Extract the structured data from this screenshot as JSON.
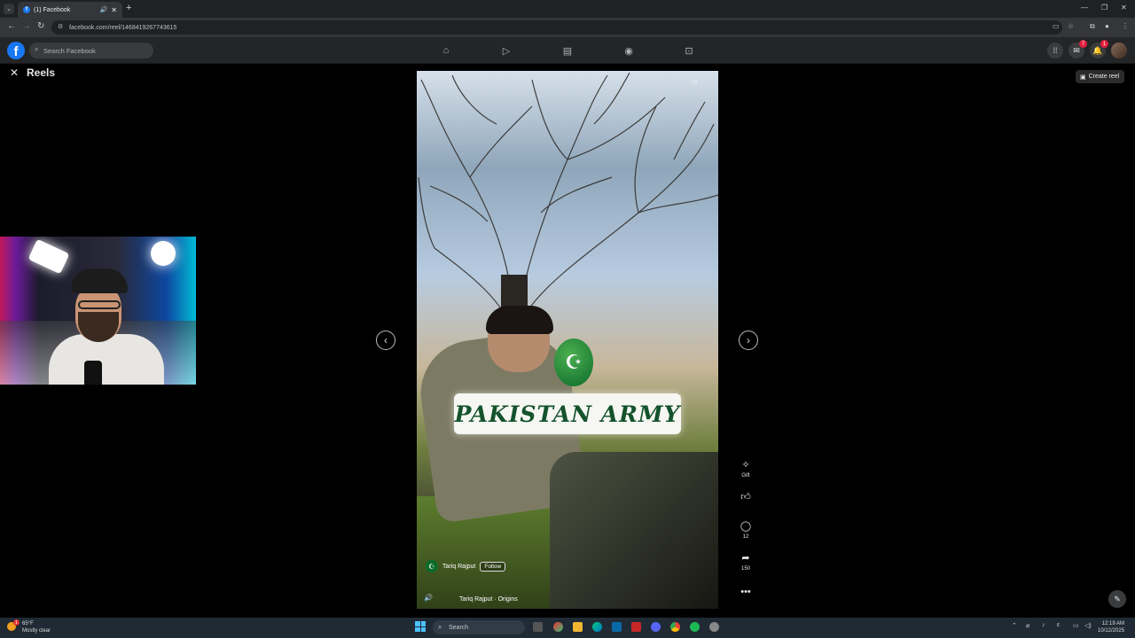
{
  "browser": {
    "tab_title": "(1) Facebook",
    "tab_favicon": "f",
    "url": "facebook.com/reel/1468419267743615",
    "new_tab": "+",
    "tab_menu": "⌄"
  },
  "facebook": {
    "logo": "f",
    "search_placeholder": "Search Facebook",
    "messenger_badge": "7",
    "notifications_badge": "1",
    "reels_title": "Reels",
    "create_reel": "Create reel"
  },
  "reel": {
    "overlay_text": "PAKISTAN ARMY",
    "author": "Tariq Rajput",
    "follow_label": "Follow",
    "audio": "Tariq Rajput · Origins"
  },
  "actions": {
    "gift_label": "Gift",
    "comments_count": "12",
    "shares_count": "150"
  },
  "taskbar": {
    "weather_temp": "65°F",
    "weather_desc": "Mostly clear",
    "weather_badge": "1",
    "search_placeholder": "Search",
    "time": "12:19 AM",
    "date": "10/12/2025"
  },
  "colors": {
    "fb_blue": "#1877f2",
    "fb_dark": "#242526",
    "notification_red": "#e41e3f",
    "banner_text_green": "#14532d"
  }
}
